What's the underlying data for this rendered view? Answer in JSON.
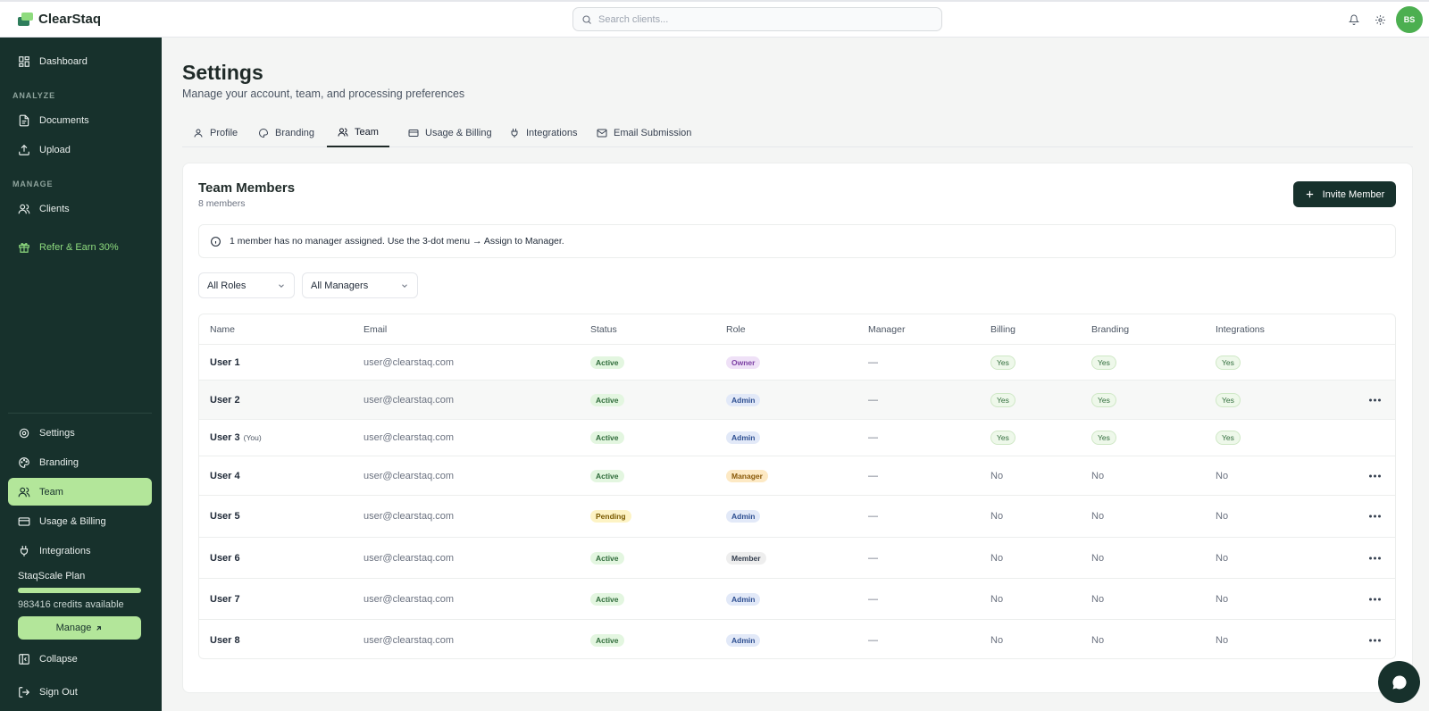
{
  "app": {
    "name": "ClearStaq"
  },
  "search": {
    "placeholder": "Search clients..."
  },
  "user": {
    "initials": "BS"
  },
  "sidebar": {
    "dashboard": "Dashboard",
    "analyze_label": "ANALYZE",
    "documents": "Documents",
    "upload": "Upload",
    "manage_label": "MANAGE",
    "clients": "Clients",
    "refer": "Refer & Earn 30%",
    "settings": "Settings",
    "branding": "Branding",
    "team": "Team",
    "usage_billing": "Usage & Billing",
    "integrations": "Integrations",
    "plan_name": "StaqScale Plan",
    "plan_progress": 1.0,
    "credits": "983416 credits available",
    "manage_button": "Manage",
    "collapse": "Collapse",
    "sign_out": "Sign Out"
  },
  "page": {
    "title": "Settings",
    "subtitle": "Manage your account, team, and processing preferences"
  },
  "tabs": [
    {
      "label": "Profile",
      "icon": "user-icon"
    },
    {
      "label": "Branding",
      "icon": "palette-icon"
    },
    {
      "label": "Team",
      "icon": "users-icon",
      "active": true
    },
    {
      "label": "Usage & Billing",
      "icon": "credit-card-icon"
    },
    {
      "label": "Integrations",
      "icon": "plug-icon"
    },
    {
      "label": "Email Submission",
      "icon": "mail-icon"
    }
  ],
  "team": {
    "title": "Team Members",
    "count": "8 members",
    "invite_button": "Invite Member",
    "notice": "1 member has no manager assigned. Use the 3-dot menu → Assign to Manager.",
    "filter_roles": "All Roles",
    "filter_managers": "All Managers"
  },
  "table": {
    "columns": [
      "Name",
      "Email",
      "Status",
      "Role",
      "Manager",
      "Billing",
      "Branding",
      "Integrations"
    ],
    "rows": [
      {
        "name": "User 1",
        "you": "",
        "email": "user@clearstaq.com",
        "status": "Active",
        "role": "Owner",
        "manager": "—",
        "billing": "Yes",
        "branding": "Yes",
        "integrations": "Yes",
        "menu": false
      },
      {
        "name": "User 2",
        "you": "",
        "email": "user@clearstaq.com",
        "status": "Active",
        "role": "Admin",
        "manager": "—",
        "billing": "Yes",
        "branding": "Yes",
        "integrations": "Yes",
        "menu": true
      },
      {
        "name": "User 3",
        "you": "(You)",
        "email": "user@clearstaq.com",
        "status": "Active",
        "role": "Admin",
        "manager": "—",
        "billing": "Yes",
        "branding": "Yes",
        "integrations": "Yes",
        "menu": false
      },
      {
        "name": "User 4",
        "you": "",
        "email": "user@clearstaq.com",
        "status": "Active",
        "role": "Manager",
        "manager": "—",
        "billing": "No",
        "branding": "No",
        "integrations": "No",
        "menu": true
      },
      {
        "name": "User 5",
        "you": "",
        "email": "user@clearstaq.com",
        "status": "Pending",
        "role": "Admin",
        "manager": "—",
        "billing": "No",
        "branding": "No",
        "integrations": "No",
        "menu": true
      },
      {
        "name": "User 6",
        "you": "",
        "email": "user@clearstaq.com",
        "status": "Active",
        "role": "Member",
        "manager": "—",
        "billing": "No",
        "branding": "No",
        "integrations": "No",
        "menu": true
      },
      {
        "name": "User 7",
        "you": "",
        "email": "user@clearstaq.com",
        "status": "Active",
        "role": "Admin",
        "manager": "—",
        "billing": "No",
        "branding": "No",
        "integrations": "No",
        "menu": true
      },
      {
        "name": "User 8",
        "you": "",
        "email": "user@clearstaq.com",
        "status": "Active",
        "role": "Admin",
        "manager": "—",
        "billing": "No",
        "branding": "No",
        "integrations": "No",
        "menu": true
      }
    ]
  },
  "colors": {
    "sidebar_bg": "#17312c",
    "accent_green": "#b3e69a",
    "status_active": "#e3f6e0",
    "status_pending": "#fdf3c4",
    "role_owner": "#efe1f7",
    "role_admin": "#e2e9f8",
    "role_manager": "#fde9c4",
    "role_member": "#eeeeee"
  }
}
